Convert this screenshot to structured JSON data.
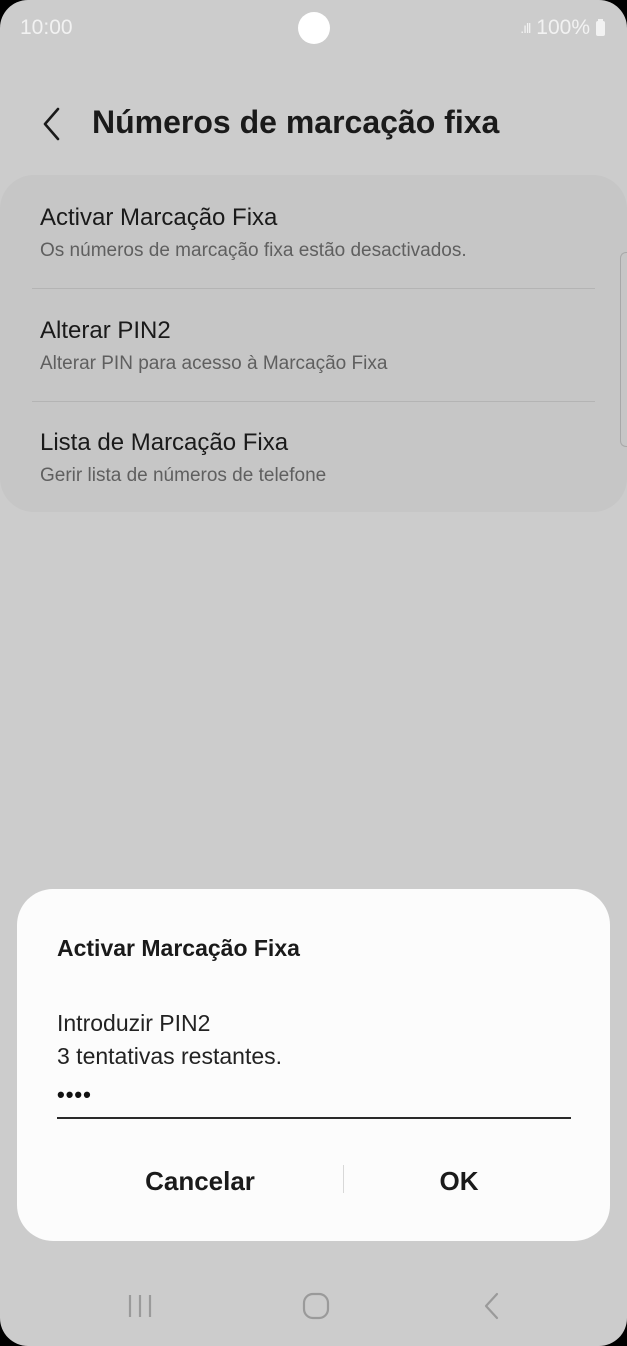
{
  "status_bar": {
    "time": "10:00",
    "signal": ".ıll",
    "battery": "100%"
  },
  "header": {
    "title": "Números de marcação fixa",
    "back_icon": "chevron-left-icon"
  },
  "settings": {
    "items": [
      {
        "title": "Activar Marcação Fixa",
        "subtitle": "Os números de marcação fixa estão desactivados."
      },
      {
        "title": "Alterar PIN2",
        "subtitle": "Alterar PIN para acesso à Marcação Fixa"
      },
      {
        "title": "Lista de Marcação Fixa",
        "subtitle": "Gerir lista de números de telefone"
      }
    ]
  },
  "dialog": {
    "title": "Activar Marcação Fixa",
    "prompt": "Introduzir PIN2",
    "attempts": "3 tentativas restantes.",
    "pin_value": "••••",
    "cancel_label": "Cancelar",
    "ok_label": "OK"
  },
  "nav_bar": {
    "recents_icon": "recents-icon",
    "home_icon": "home-icon",
    "back_icon": "back-icon"
  },
  "colors": {
    "background": "#cccccc",
    "card": "#c6c6c6",
    "dialog": "#fcfcfc",
    "text": "#1a1a1a"
  }
}
